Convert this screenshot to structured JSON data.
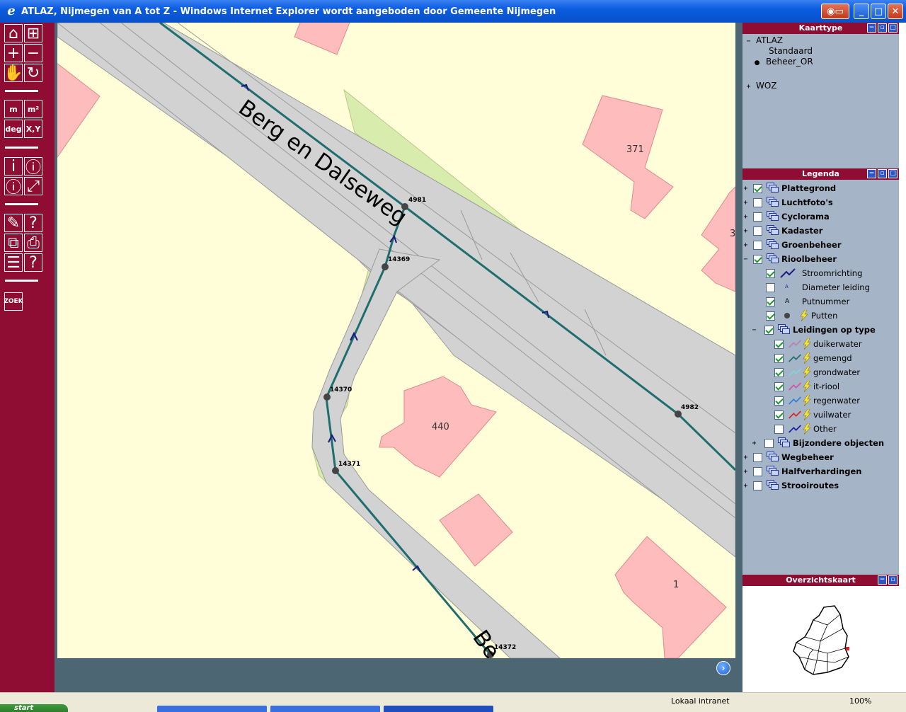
{
  "window": {
    "title": "ATLAZ, Nijmegen van A tot Z - Windows Internet Explorer wordt aangeboden door Gemeente Nijmegen"
  },
  "toolbar": {
    "measure_length": "m",
    "measure_area": "m²",
    "measure_angle": "deg",
    "coords": "X,Y",
    "search": "ZOEK"
  },
  "map": {
    "street_name": "Berg en Dalseweg",
    "street_name_partial": "Be",
    "buildings": [
      "371",
      "440",
      "1",
      "3"
    ],
    "manholes": [
      "4981",
      "14369",
      "14370",
      "14371",
      "14372",
      "4982"
    ]
  },
  "kaarttype": {
    "title": "Kaarttype",
    "group": "ATLAZ",
    "options": [
      "Standaard",
      "Beheer_OR"
    ],
    "selected": "Beheer_OR",
    "group2": "WOZ"
  },
  "legenda": {
    "title": "Legenda",
    "layers": [
      {
        "label": "Plattegrond",
        "checked": true
      },
      {
        "label": "Luchtfoto's",
        "checked": false
      },
      {
        "label": "Cyclorama",
        "checked": false
      },
      {
        "label": "Kadaster",
        "checked": false
      },
      {
        "label": "Groenbeheer",
        "checked": false
      },
      {
        "label": "Rioolbeheer",
        "checked": true
      }
    ],
    "riool_sub": [
      {
        "label": "Stroomrichting",
        "checked": true
      },
      {
        "label": "Diameter leiding",
        "checked": false
      },
      {
        "label": "Putnummer",
        "checked": true
      },
      {
        "label": "Putten",
        "checked": true
      }
    ],
    "leidingen_group": "Leidingen op type",
    "leidingen": [
      {
        "label": "duikerwater",
        "checked": true,
        "color": "#b77fb5"
      },
      {
        "label": "gemengd",
        "checked": true,
        "color": "#1f6e6e"
      },
      {
        "label": "grondwater",
        "checked": true,
        "color": "#7fd6d6"
      },
      {
        "label": "it-riool",
        "checked": true,
        "color": "#d84fa6"
      },
      {
        "label": "regenwater",
        "checked": true,
        "color": "#2f7de0"
      },
      {
        "label": "vuilwater",
        "checked": true,
        "color": "#e02020"
      },
      {
        "label": "Other",
        "checked": false,
        "color": "#1a1aa8"
      }
    ],
    "bijzondere": "Bijzondere objecten",
    "layers_bottom": [
      {
        "label": "Wegbeheer",
        "checked": false
      },
      {
        "label": "Halfverhardingen",
        "checked": false
      },
      {
        "label": "Strooiroutes",
        "checked": false
      }
    ]
  },
  "overzicht": {
    "title": "Overzichtskaart"
  },
  "statusbar": {
    "zone": "Lokaal intranet",
    "zoom": "100%"
  },
  "taskbar": {
    "start": "start"
  }
}
